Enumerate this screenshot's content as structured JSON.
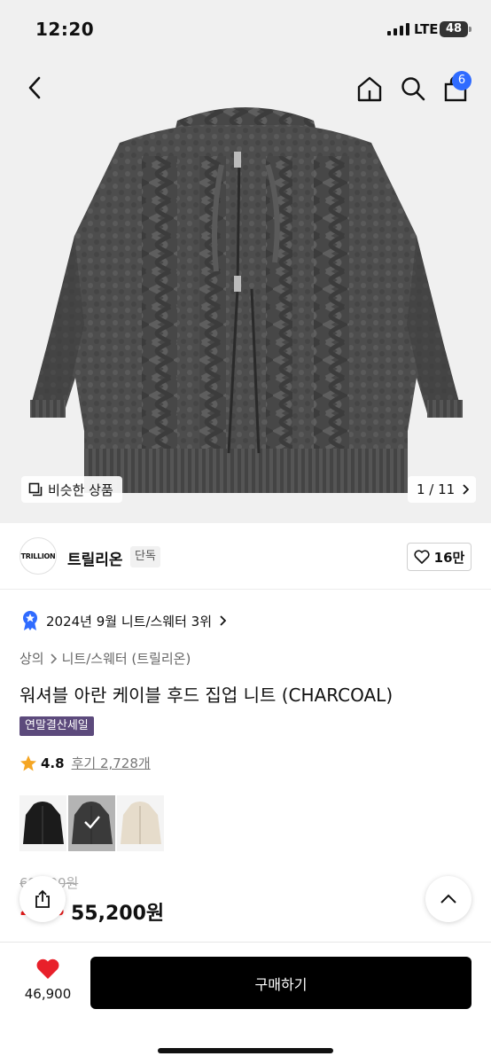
{
  "status_bar": {
    "time": "12:20",
    "network": "LTE",
    "battery": "48"
  },
  "nav": {
    "cart_count": "6"
  },
  "gallery": {
    "similar_label": "비슷한 상품",
    "counter": "1 / 11"
  },
  "brand": {
    "logo_text": "TRILLION",
    "name": "트릴리온",
    "badge": "단독",
    "likes": "16만"
  },
  "ranking": {
    "text": "2024년 9월 니트/스웨터 3위"
  },
  "breadcrumb": {
    "items": [
      "상의",
      "니트/스웨터 (트릴리온)"
    ]
  },
  "product": {
    "title": "워셔블 아란 케이블 후드 집업 니트 (CHARCOAL)",
    "sale_badge": "연말결산세일",
    "rating": "4.8",
    "reviews": "후기 2,728개",
    "colors": [
      "black",
      "charcoal",
      "ivory"
    ],
    "original_price": "69,000원",
    "discount": "20%",
    "sale_price": "55,200원"
  },
  "bottom_bar": {
    "wish_count": "46,900",
    "buy_label": "구매하기"
  },
  "colors": {
    "accent_blue": "#2f6bff",
    "sale_red": "#e61a1a",
    "sale_badge_bg": "#5c4a7c",
    "heart_red": "#e8202a",
    "star": "#f5a623"
  }
}
